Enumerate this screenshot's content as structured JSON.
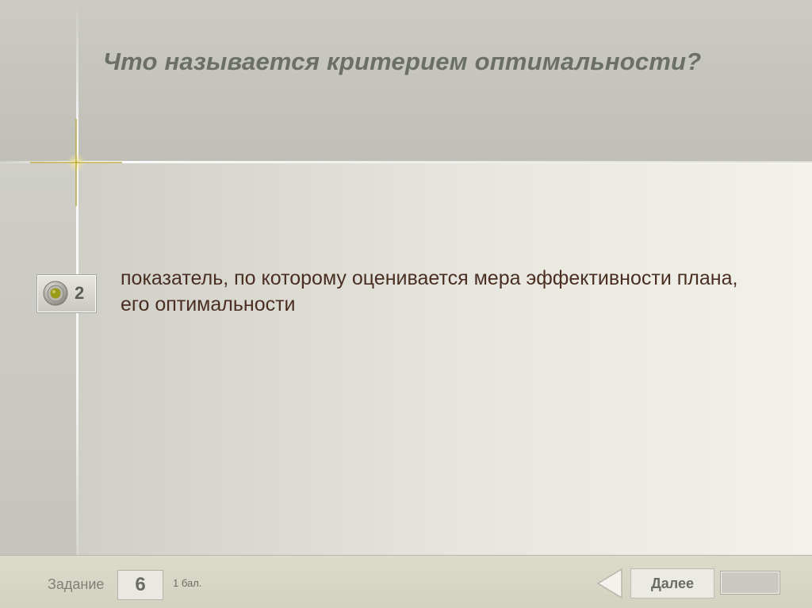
{
  "question": {
    "title": "Что называется критерием оптимальности?"
  },
  "answer": {
    "number": "2",
    "text": "показатель, по которому оценивается мера эффективности плана, его оптимальности",
    "selected": true
  },
  "footer": {
    "task_label": "Задание",
    "task_number": "6",
    "points": "1 бал.",
    "next_label": "Далее"
  },
  "icons": {
    "radio": "radio-selected-icon",
    "back": "back-triangle-icon",
    "sparkle": "sparkle-decoration-icon"
  },
  "colors": {
    "title": "#6b7066",
    "answer_text": "#4a2e22",
    "accent_olive": "#9a9a1a"
  }
}
